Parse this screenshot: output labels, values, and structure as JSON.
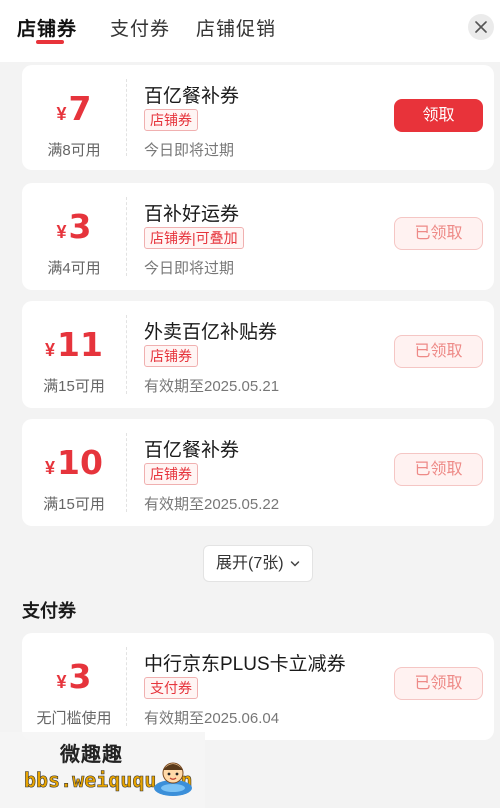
{
  "tabs": [
    {
      "label": "店铺券"
    },
    {
      "label": "支付券"
    },
    {
      "label": "店铺促销"
    }
  ],
  "store_coupons": [
    {
      "currency": "¥",
      "amount": "7",
      "condition": "满8可用",
      "title": "百亿餐补券",
      "tag": "店铺券",
      "validity": "今日即将过期",
      "button": "领取",
      "claimed": false
    },
    {
      "currency": "¥",
      "amount": "3",
      "condition": "满4可用",
      "title": "百补好运券",
      "tag": "店铺券|可叠加",
      "validity": "今日即将过期",
      "button": "已领取",
      "claimed": true
    },
    {
      "currency": "¥",
      "amount": "11",
      "condition": "满15可用",
      "title": "外卖百亿补贴券",
      "tag": "店铺券",
      "validity": "有效期至2025.05.21",
      "button": "已领取",
      "claimed": true
    },
    {
      "currency": "¥",
      "amount": "10",
      "condition": "满15可用",
      "title": "百亿餐补券",
      "tag": "店铺券",
      "validity": "有效期至2025.05.22",
      "button": "已领取",
      "claimed": true
    }
  ],
  "expand": {
    "label": "展开(7张)"
  },
  "payment_section": {
    "title": "支付券"
  },
  "payment_coupons": [
    {
      "currency": "¥",
      "amount": "3",
      "condition": "无门槛使用",
      "title": "中行京东PLUS卡立减券",
      "tag": "支付券",
      "validity": "有效期至2025.06.04",
      "button": "已领取",
      "claimed": true
    }
  ],
  "watermark": {
    "logo_text": "微趣趣",
    "url": "bbs.weiququ.cn"
  },
  "colors": {
    "accent": "#e8333a",
    "background": "#f3f3f3"
  },
  "icons": {
    "close": "close-icon",
    "expand": "chevron-down-icon"
  }
}
